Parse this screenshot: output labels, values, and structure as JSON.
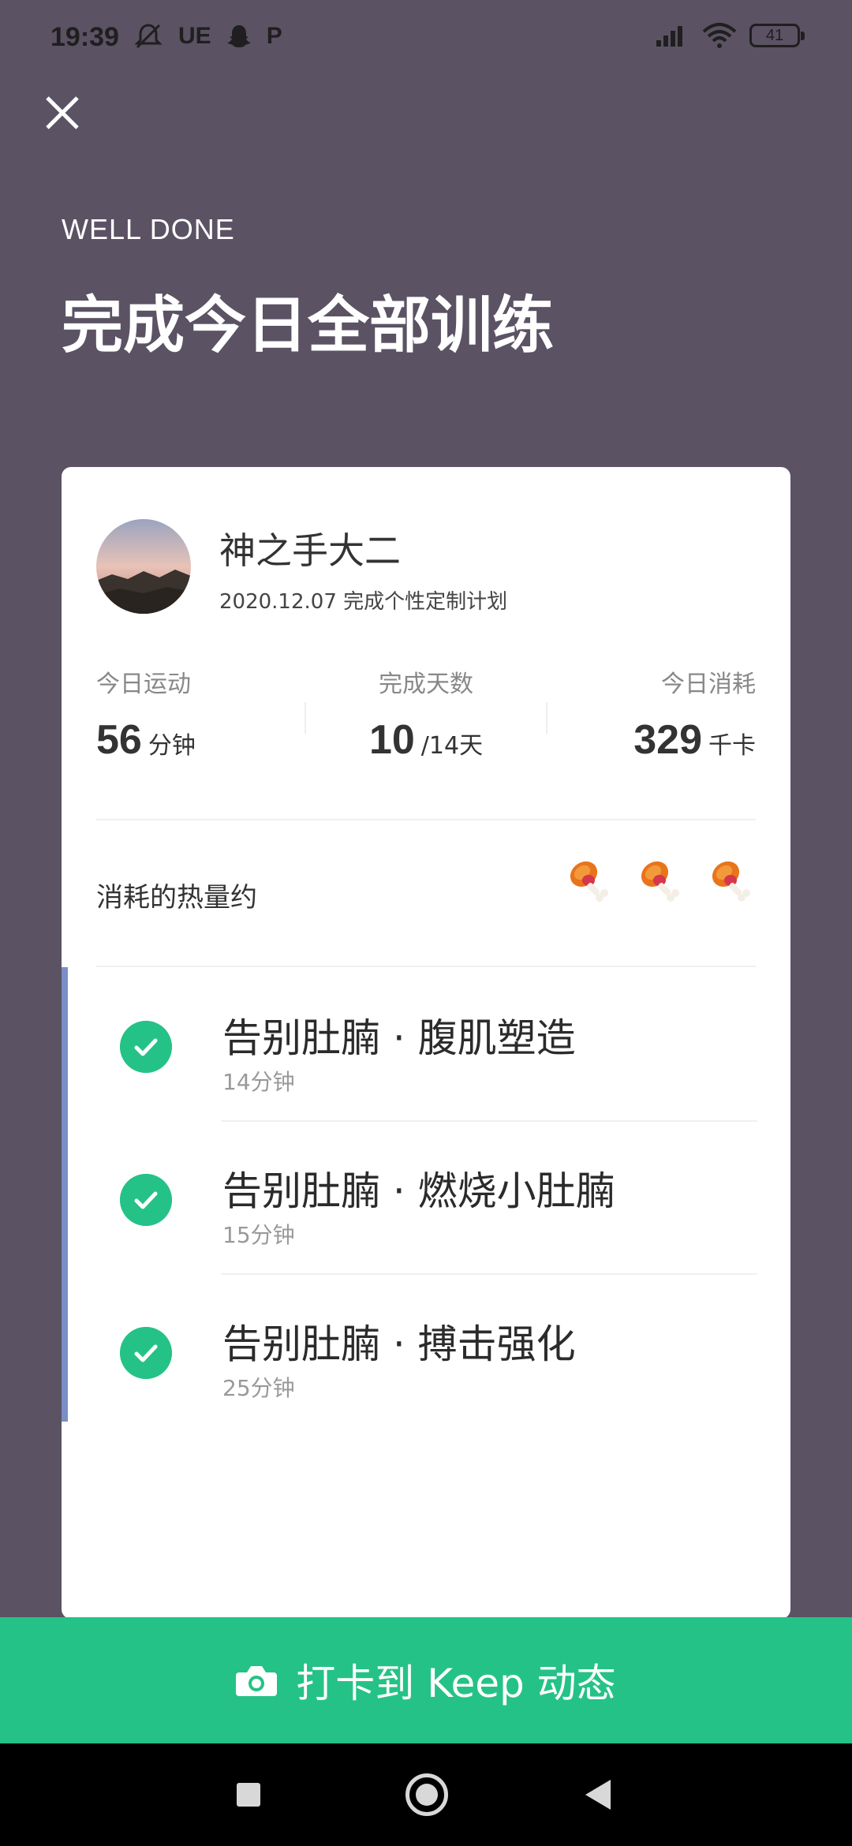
{
  "status_bar": {
    "time": "19:39",
    "left_icons": [
      "mute-icon",
      "UE",
      "snapchat-icon",
      "P"
    ],
    "battery": "41"
  },
  "header": {
    "eyebrow": "WELL DONE",
    "title": "完成今日全部训练"
  },
  "card": {
    "user_name": "神之手大二",
    "user_sub": "2020.12.07 完成个性定制计划",
    "stats": [
      {
        "label": "今日运动",
        "value": "56",
        "unit": "分钟"
      },
      {
        "label": "完成天数",
        "value": "10",
        "unit": "/14天"
      },
      {
        "label": "今日消耗",
        "value": "329",
        "unit": "千卡"
      }
    ],
    "calorie_label": "消耗的热量约",
    "calorie_icon": "drumstick-icon",
    "workouts": [
      {
        "title": "告别肚腩 · 腹肌塑造",
        "duration": "14分钟"
      },
      {
        "title": "告别肚腩 · 燃烧小肚腩",
        "duration": "15分钟"
      },
      {
        "title": "告别肚腩 · 搏击强化",
        "duration": "25分钟"
      }
    ]
  },
  "cta": {
    "label": "打卡到 Keep 动态",
    "icon": "camera-icon"
  },
  "colors": {
    "background": "#5b5264",
    "accent_green": "#25c287",
    "timeline_blue": "#7a8fc6"
  }
}
